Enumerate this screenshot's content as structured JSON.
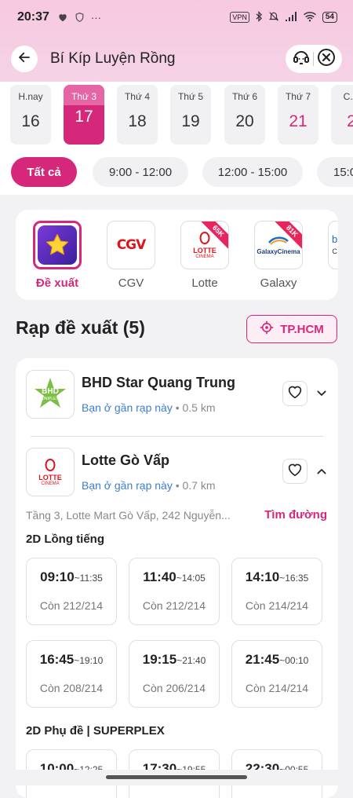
{
  "status": {
    "time": "20:37",
    "battery": "54",
    "vpn": "VPN",
    "dots": "···"
  },
  "header": {
    "title": "Bí Kíp Luyện Rồng"
  },
  "dates": [
    {
      "label": "H.nay",
      "day": "16",
      "state": "normal"
    },
    {
      "label": "Thứ 3",
      "day": "17",
      "state": "selected"
    },
    {
      "label": "Thứ 4",
      "day": "18",
      "state": "normal"
    },
    {
      "label": "Thứ 5",
      "day": "19",
      "state": "normal"
    },
    {
      "label": "Thứ 6",
      "day": "20",
      "state": "normal"
    },
    {
      "label": "Thứ 7",
      "day": "21",
      "state": "weekend"
    },
    {
      "label": "C.N",
      "day": "2",
      "state": "weekend"
    }
  ],
  "time_filters": [
    "Tất cả",
    "9:00 - 12:00",
    "12:00 - 15:00",
    "15:0"
  ],
  "chains": [
    {
      "label": "Đề xuất",
      "selected": true
    },
    {
      "label": "CGV",
      "selected": false
    },
    {
      "label": "Lotte",
      "selected": false,
      "badge": "65K"
    },
    {
      "label": "Galaxy",
      "selected": false,
      "badge": "81K"
    },
    {
      "label": "",
      "selected": false
    }
  ],
  "logos": {
    "cgv": "CGV",
    "lotte": "LOTTE",
    "lotte_sub": "CINEMA",
    "galaxy": "GalaxyCinema",
    "bhd": "BHD",
    "bhd_sub": "UNIPLEX",
    "peek": "b",
    "peek_sub": "C"
  },
  "section": {
    "title": "Rạp đề xuất (5)",
    "city": "TP.HCM"
  },
  "cinemas": [
    {
      "name": "BHD Star Quang Trung",
      "near": "Bạn ở gần rạp này",
      "distance": "• 0.5 km"
    },
    {
      "name": "Lotte Gò Vấp",
      "near": "Bạn ở gần rạp này",
      "distance": "• 0.7 km"
    }
  ],
  "address": "Tầng 3, Lotte Mart Gò Vấp, 242 Nguyễn...",
  "directions": "Tìm đường",
  "formats": [
    {
      "name": "2D Lồng tiếng",
      "slots": [
        {
          "start": "09:10",
          "end": "~11:35",
          "seats": "Còn 212/214"
        },
        {
          "start": "11:40",
          "end": "~14:05",
          "seats": "Còn 212/214"
        },
        {
          "start": "14:10",
          "end": "~16:35",
          "seats": "Còn 214/214"
        },
        {
          "start": "16:45",
          "end": "~19:10",
          "seats": "Còn 208/214"
        },
        {
          "start": "19:15",
          "end": "~21:40",
          "seats": "Còn 206/214"
        },
        {
          "start": "21:45",
          "end": "~00:10",
          "seats": "Còn 214/214"
        }
      ]
    },
    {
      "name": "2D Phụ đề | SUPERPLEX",
      "slots": [
        {
          "start": "10:00",
          "end": "~12:25",
          "seats": ""
        },
        {
          "start": "17:30",
          "end": "~19:55",
          "seats": ""
        },
        {
          "start": "22:30",
          "end": "~00:55",
          "seats": ""
        }
      ]
    }
  ],
  "colors": {
    "accent": "#d6287a",
    "link": "#3d7fcc"
  }
}
